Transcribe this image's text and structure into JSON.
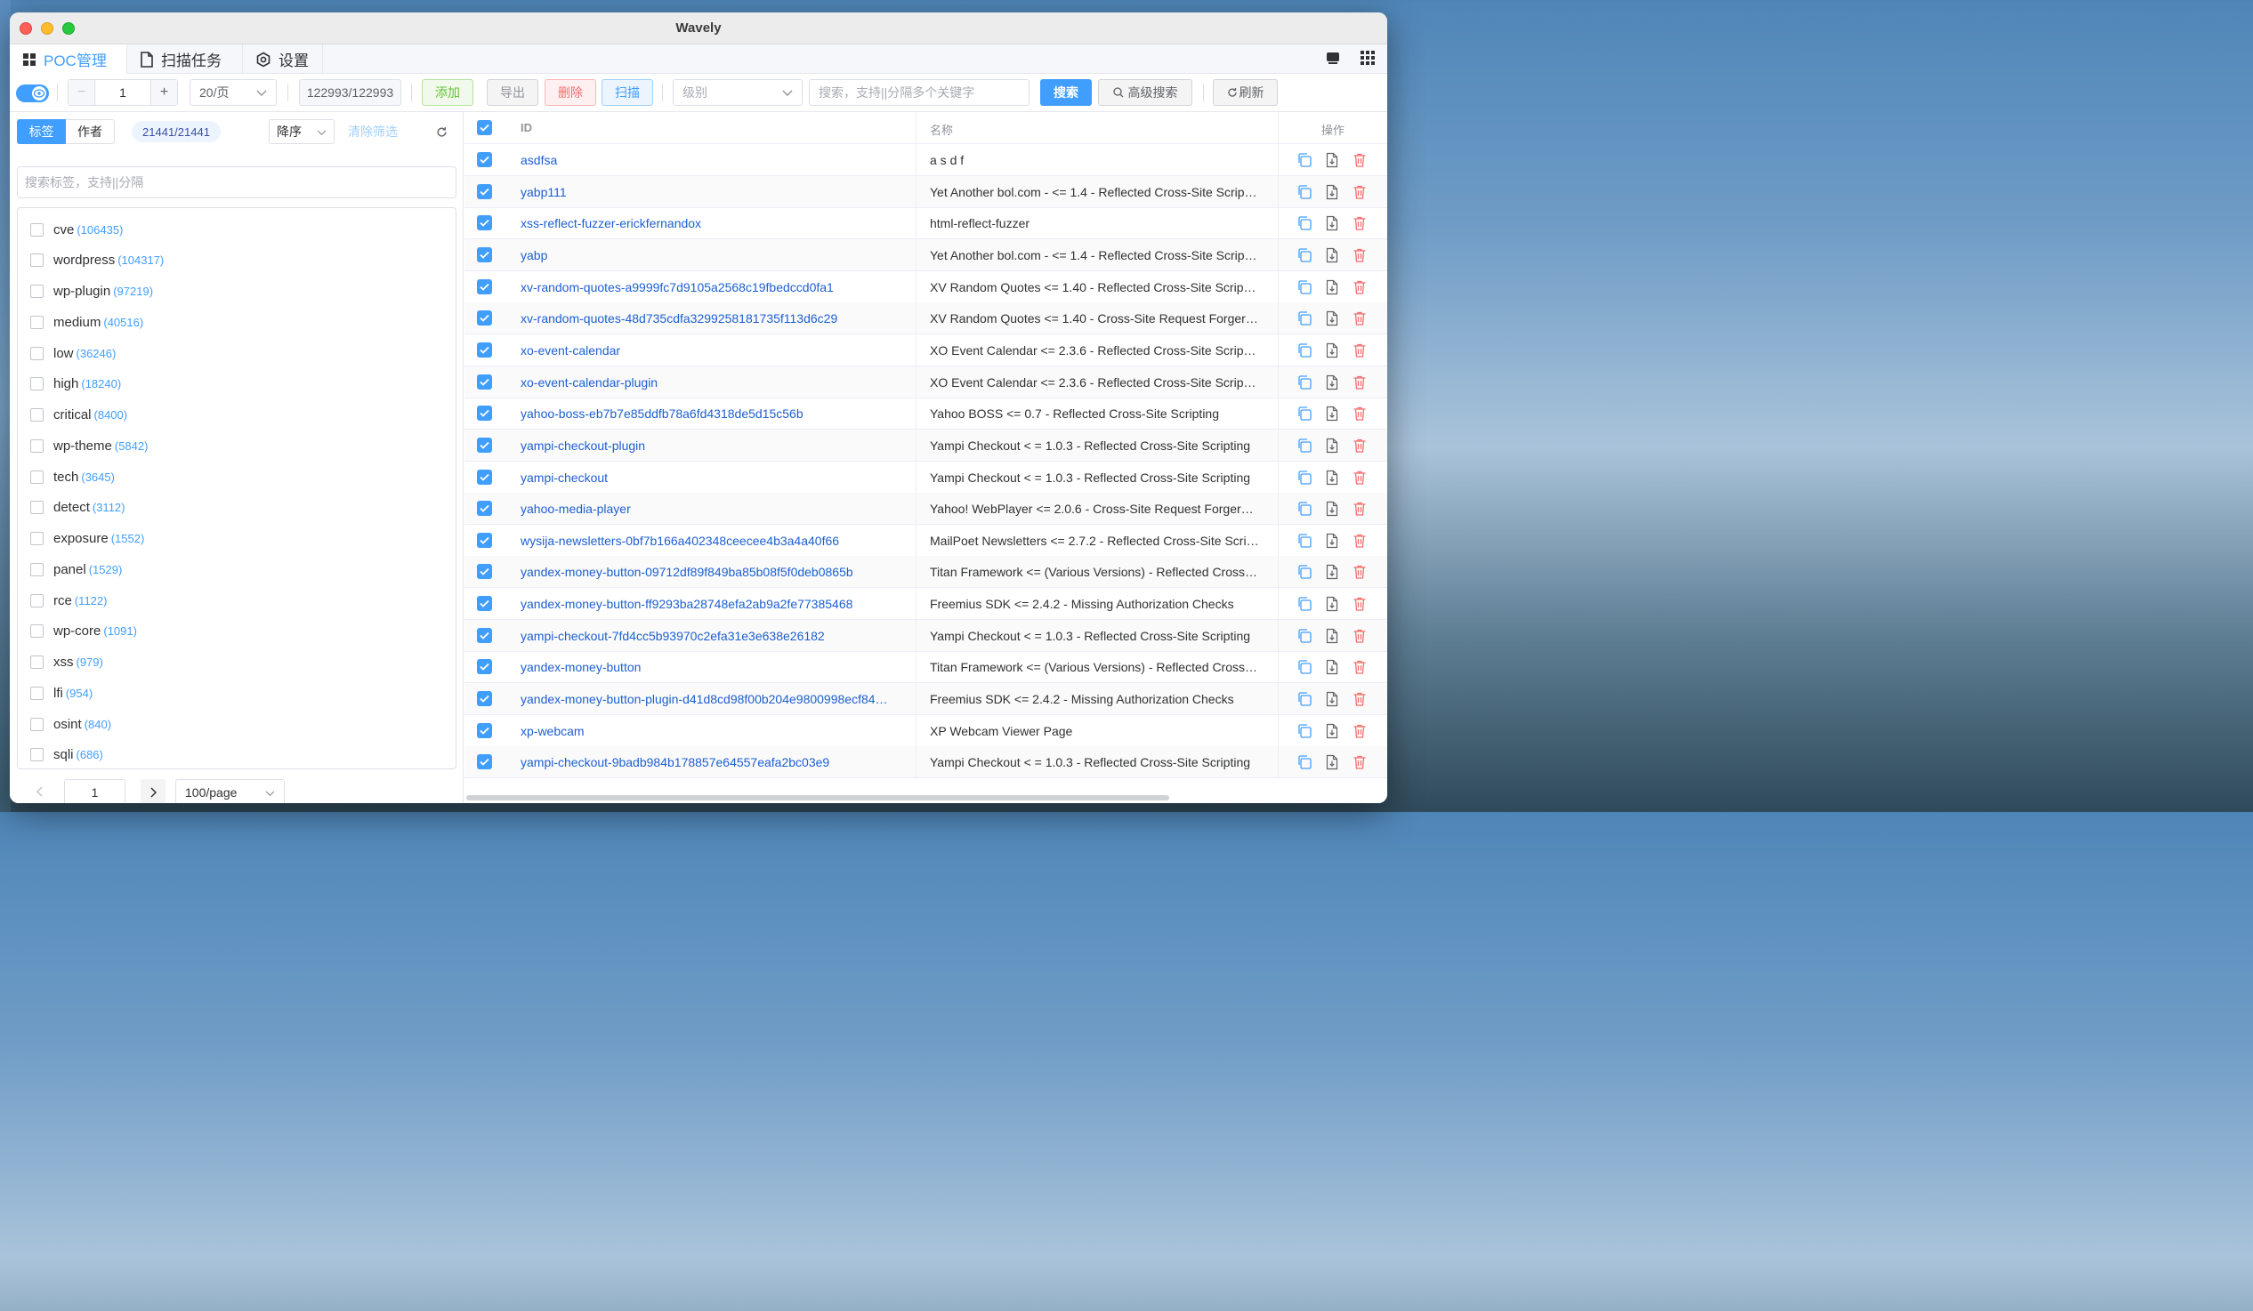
{
  "window": {
    "title": "Wavely"
  },
  "menu": {
    "tabs": [
      {
        "label": "POC管理",
        "icon": "grid-icon"
      },
      {
        "label": "扫描任务",
        "icon": "document-icon"
      },
      {
        "label": "设置",
        "icon": "gear-icon"
      }
    ]
  },
  "toolbar": {
    "page_input": "1",
    "page_size": "20/页",
    "count": "122993/122993",
    "add": "添加",
    "export": "导出",
    "delete": "删除",
    "scan": "扫描",
    "level_placeholder": "级别",
    "search_placeholder": "搜索，支持||分隔多个关键字",
    "search": "搜索",
    "advanced": "高级搜索",
    "refresh": "刷新"
  },
  "left": {
    "tab_tags": "标签",
    "tab_author": "作者",
    "count": "21441/21441",
    "sort": "降序",
    "clear": "清除筛选",
    "search_placeholder": "搜索标签，支持||分隔",
    "page_input": "1",
    "page_size": "100/page",
    "tags": [
      {
        "name": "cve",
        "count": "(106435)"
      },
      {
        "name": "wordpress",
        "count": "(104317)"
      },
      {
        "name": "wp-plugin",
        "count": "(97219)"
      },
      {
        "name": "medium",
        "count": "(40516)"
      },
      {
        "name": "low",
        "count": "(36246)"
      },
      {
        "name": "high",
        "count": "(18240)"
      },
      {
        "name": "critical",
        "count": "(8400)"
      },
      {
        "name": "wp-theme",
        "count": "(5842)"
      },
      {
        "name": "tech",
        "count": "(3645)"
      },
      {
        "name": "detect",
        "count": "(3112)"
      },
      {
        "name": "exposure",
        "count": "(1552)"
      },
      {
        "name": "panel",
        "count": "(1529)"
      },
      {
        "name": "rce",
        "count": "(1122)"
      },
      {
        "name": "wp-core",
        "count": "(1091)"
      },
      {
        "name": "xss",
        "count": "(979)"
      },
      {
        "name": "lfi",
        "count": "(954)"
      },
      {
        "name": "osint",
        "count": "(840)"
      },
      {
        "name": "sqli",
        "count": "(686)"
      }
    ]
  },
  "table": {
    "col_id": "ID",
    "col_name": "名称",
    "col_ops": "操作",
    "rows": [
      {
        "id": "asdfsa",
        "name": "a s d f"
      },
      {
        "id": "yabp111",
        "name": "Yet Another bol.com - <= 1.4 - Reflected Cross-Site Scrip…"
      },
      {
        "id": "xss-reflect-fuzzer-erickfernandox",
        "name": "html-reflect-fuzzer"
      },
      {
        "id": "yabp",
        "name": "Yet Another bol.com - <= 1.4 - Reflected Cross-Site Scrip…"
      },
      {
        "id": "xv-random-quotes-a9999fc7d9105a2568c19fbedccd0fa1",
        "name": "XV Random Quotes <= 1.40 - Reflected Cross-Site Script…"
      },
      {
        "id": "xv-random-quotes-48d735cdfa3299258181735f113d6c29",
        "name": "XV Random Quotes <= 1.40 - Cross-Site Request Forger…"
      },
      {
        "id": "xo-event-calendar",
        "name": "XO Event Calendar <= 2.3.6 - Reflected Cross-Site Script…"
      },
      {
        "id": "xo-event-calendar-plugin",
        "name": "XO Event Calendar <= 2.3.6 - Reflected Cross-Site Script…"
      },
      {
        "id": "yahoo-boss-eb7b7e85ddfb78a6fd4318de5d15c56b",
        "name": "Yahoo BOSS <= 0.7 - Reflected Cross-Site Scripting"
      },
      {
        "id": "yampi-checkout-plugin",
        "name": "Yampi Checkout < = 1.0.3 - Reflected Cross-Site Scripting"
      },
      {
        "id": "yampi-checkout",
        "name": "Yampi Checkout < = 1.0.3 - Reflected Cross-Site Scripting"
      },
      {
        "id": "yahoo-media-player",
        "name": "Yahoo! WebPlayer <= 2.0.6 - Cross-Site Request Forgery …"
      },
      {
        "id": "wysija-newsletters-0bf7b166a402348ceecee4b3a4a40f66",
        "name": "MailPoet Newsletters <= 2.7.2 - Reflected Cross-Site Scri…"
      },
      {
        "id": "yandex-money-button-09712df89f849ba85b08f5f0deb0865b",
        "name": "Titan Framework <= (Various Versions) - Reflected Cross-…"
      },
      {
        "id": "yandex-money-button-ff9293ba28748efa2ab9a2fe77385468",
        "name": "Freemius SDK <= 2.4.2 - Missing Authorization Checks"
      },
      {
        "id": "yampi-checkout-7fd4cc5b93970c2efa31e3e638e26182",
        "name": "Yampi Checkout < = 1.0.3 - Reflected Cross-Site Scripting"
      },
      {
        "id": "yandex-money-button",
        "name": "Titan Framework <= (Various Versions) - Reflected Cross-…"
      },
      {
        "id": "yandex-money-button-plugin-d41d8cd98f00b204e9800998ecf84…",
        "name": "Freemius SDK <= 2.4.2 - Missing Authorization Checks"
      },
      {
        "id": "xp-webcam",
        "name": "XP Webcam Viewer Page"
      },
      {
        "id": "yampi-checkout-9badb984b178857e64557eafa2bc03e9",
        "name": "Yampi Checkout < = 1.0.3 - Reflected Cross-Site Scripting"
      }
    ]
  }
}
